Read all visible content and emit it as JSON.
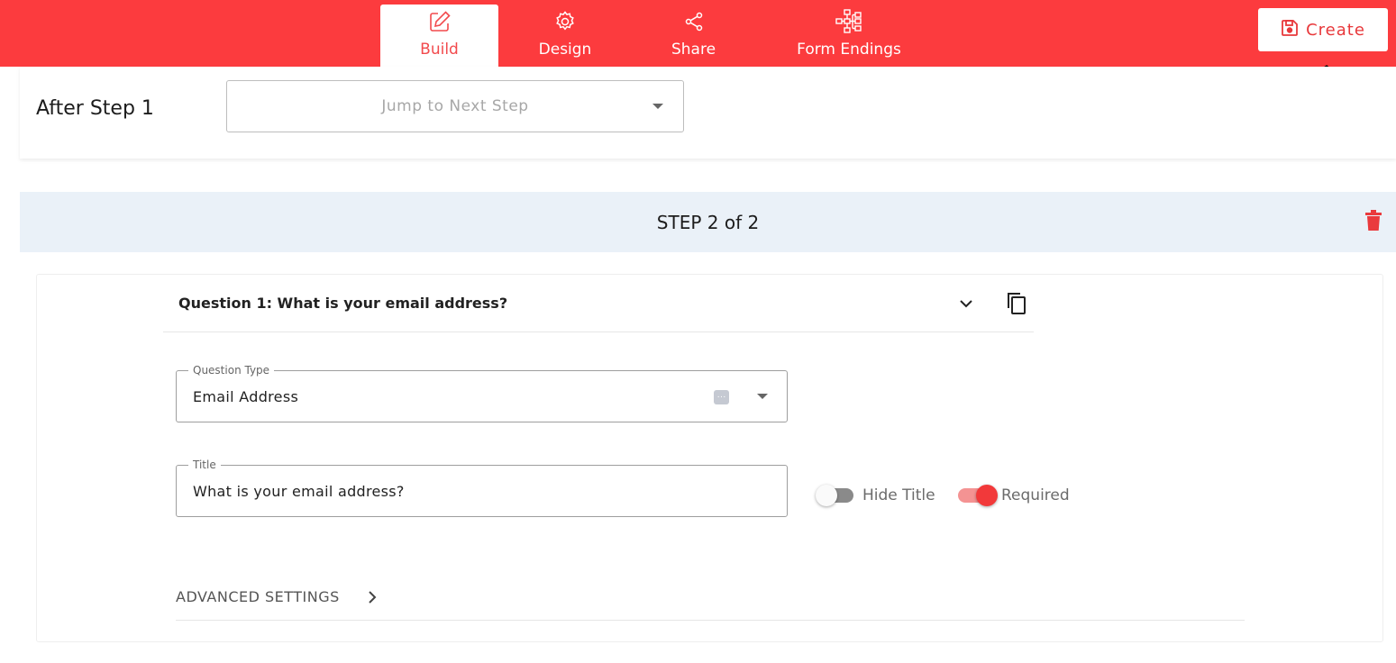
{
  "topbar": {
    "tabs": [
      {
        "label": "Build",
        "icon": "pencil-square-icon",
        "active": true
      },
      {
        "label": "Design",
        "icon": "gear-icon",
        "active": false
      },
      {
        "label": "Share",
        "icon": "share-icon",
        "active": false
      },
      {
        "label": "Form Endings",
        "icon": "flow-diagram-icon",
        "active": false
      }
    ],
    "create_label": "Create",
    "create_icon": "save-icon"
  },
  "step1": {
    "after_label": "After Step 1",
    "jump_placeholder": "Jump to Next Step"
  },
  "step2": {
    "header": "STEP 2 of 2",
    "question": {
      "title": "Question 1: What is your email address?",
      "type_label": "Question Type",
      "type_value": "Email Address",
      "title_label": "Title",
      "title_value": "What is your email address?",
      "hide_title_label": "Hide Title",
      "hide_title_on": false,
      "required_label": "Required",
      "required_on": true,
      "advanced_label": "ADVANCED SETTINGS"
    }
  },
  "colors": {
    "brand": "#fc3b3e",
    "step_header_bg": "#eaf1f8"
  }
}
